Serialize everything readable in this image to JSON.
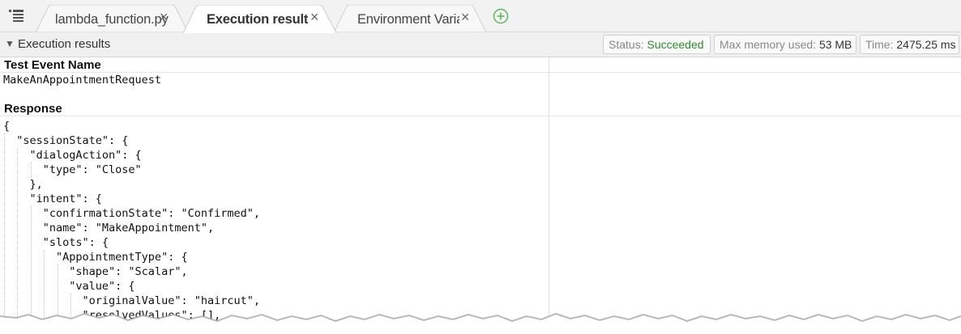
{
  "tabs": [
    {
      "label": "lambda_function.py",
      "active": false
    },
    {
      "label": "Execution results",
      "active": true
    },
    {
      "label": "Environment Variables",
      "active": false
    }
  ],
  "icons": {
    "menu": "list-menu-icon",
    "close": "×",
    "add": "add-tab-icon",
    "collapse": "▼"
  },
  "results": {
    "title": "Execution results",
    "status_label": "Status:",
    "status_value": "Succeeded",
    "memory_label": "Max memory used:",
    "memory_value": "53 MB",
    "time_label": "Time:",
    "time_value": "2475.25 ms"
  },
  "test_event": {
    "heading": "Test Event Name",
    "name": "MakeAnAppointmentRequest"
  },
  "response": {
    "heading": "Response",
    "lines": [
      "{",
      "  \"sessionState\": {",
      "    \"dialogAction\": {",
      "      \"type\": \"Close\"",
      "    },",
      "    \"intent\": {",
      "      \"confirmationState\": \"Confirmed\",",
      "      \"name\": \"MakeAppointment\",",
      "      \"slots\": {",
      "        \"AppointmentType\": {",
      "          \"shape\": \"Scalar\",",
      "          \"value\": {",
      "            \"originalValue\": \"haircut\",",
      "            \"resolvedValues\": [],"
    ]
  },
  "colors": {
    "success": "#2e8b2e",
    "add_icon": "#5cb85c",
    "tab_bar": "#f2f2f2"
  }
}
